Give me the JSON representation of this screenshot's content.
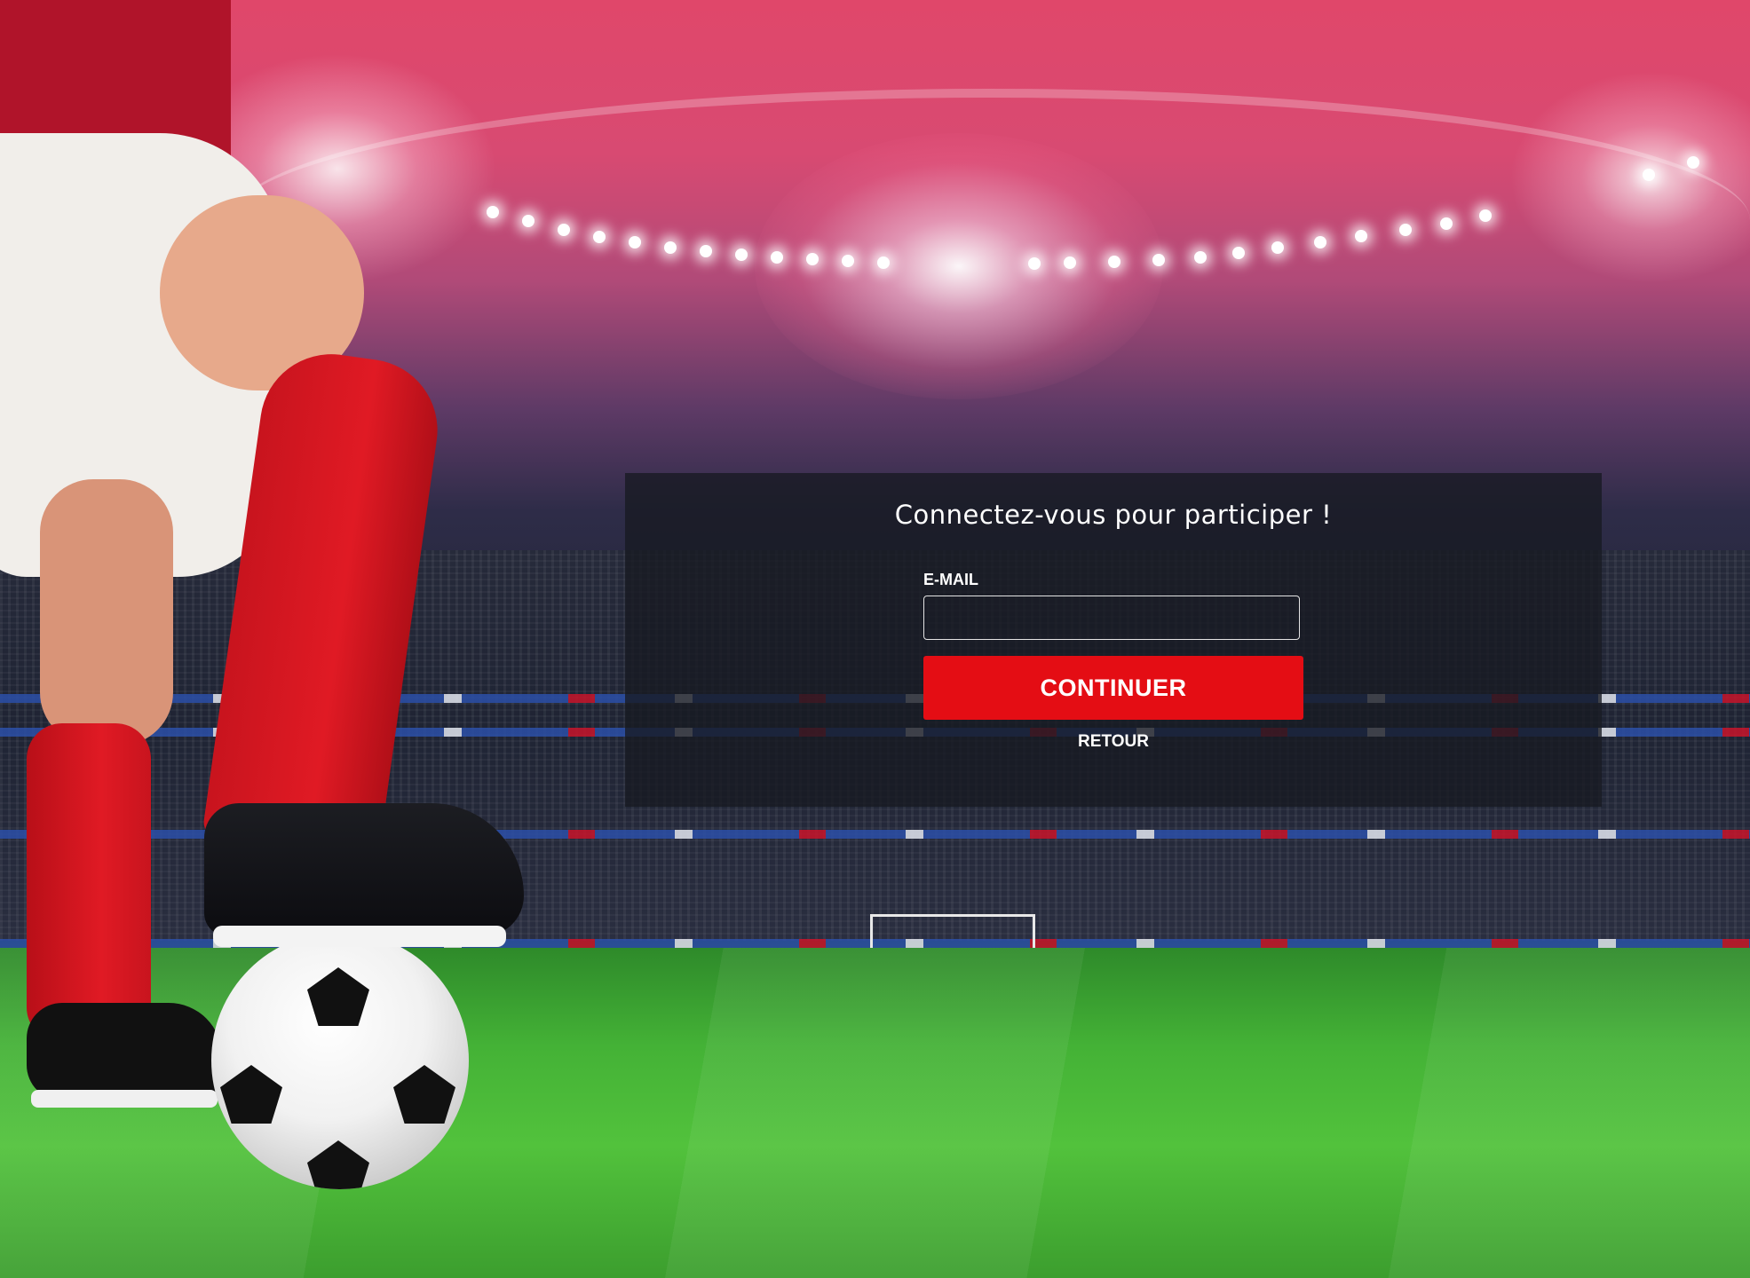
{
  "login": {
    "title": "Connectez-vous pour participer !",
    "email_label": "E-MAIL",
    "email_value": "",
    "email_placeholder": "",
    "continue_label": "CONTINUER",
    "back_label": "RETOUR"
  },
  "theme": {
    "accent": "#e40d14",
    "panel_background": "#17191f",
    "text": "#ffffff"
  },
  "background": {
    "scene": "stadium-with-football-player-photo"
  }
}
